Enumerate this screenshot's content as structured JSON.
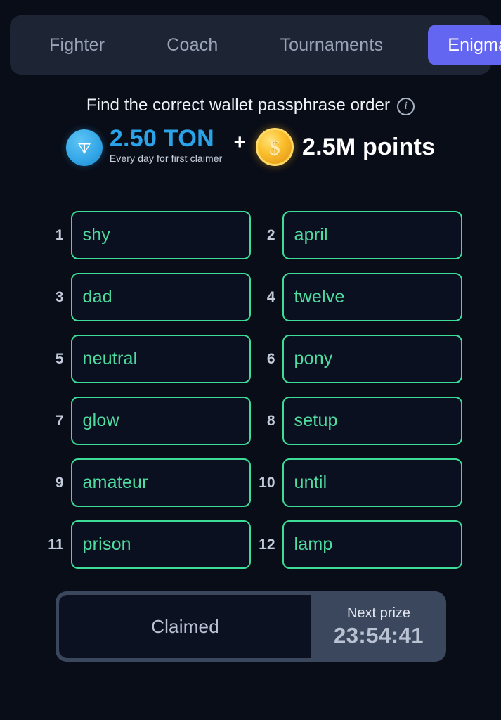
{
  "theme": {
    "background": "#090d18",
    "tabbar_bg": "#1d2433",
    "accent_purple": "#6366f1",
    "accent_green": "#3ddc97",
    "ton_blue": "#2aa3e8",
    "coin_gold": "#fbc02d",
    "claimbar_bg": "#3a475c"
  },
  "tabs": [
    {
      "label": "Fighter",
      "active": false
    },
    {
      "label": "Coach",
      "active": false
    },
    {
      "label": "Tournaments",
      "active": false
    },
    {
      "label": "Enigma",
      "active": true
    }
  ],
  "header": {
    "title": "Find the correct wallet passphrase order",
    "info_icon": "info-circle-icon"
  },
  "prize": {
    "ton_icon": "ton-coin-icon",
    "ton_amount": "2.50 TON",
    "ton_subtitle": "Every day for first claimer",
    "separator": "+",
    "points_icon": "gold-coin-icon",
    "points_amount": "2.5M points"
  },
  "grid": {
    "cells": [
      {
        "number": "1",
        "word": "shy"
      },
      {
        "number": "2",
        "word": "april"
      },
      {
        "number": "3",
        "word": "dad"
      },
      {
        "number": "4",
        "word": "twelve"
      },
      {
        "number": "5",
        "word": "neutral"
      },
      {
        "number": "6",
        "word": "pony"
      },
      {
        "number": "7",
        "word": "glow"
      },
      {
        "number": "8",
        "word": "setup"
      },
      {
        "number": "9",
        "word": "amateur"
      },
      {
        "number": "10",
        "word": "until"
      },
      {
        "number": "11",
        "word": "prison"
      },
      {
        "number": "12",
        "word": "lamp"
      }
    ]
  },
  "claimbar": {
    "claim_label": "Claimed",
    "next_prize_label": "Next prize",
    "next_prize_time": "23:54:41"
  }
}
